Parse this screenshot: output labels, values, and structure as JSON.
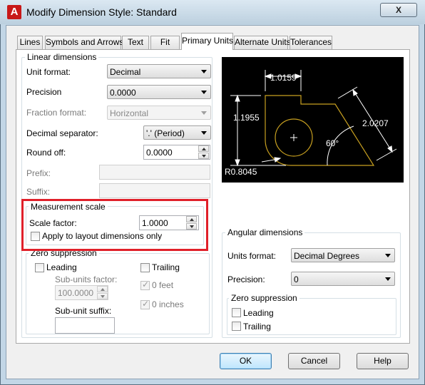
{
  "window": {
    "title": "Modify Dimension Style: Standard",
    "close_label": "X"
  },
  "tabs": [
    {
      "label": "Lines"
    },
    {
      "label": "Symbols and Arrows"
    },
    {
      "label": "Text"
    },
    {
      "label": "Fit"
    },
    {
      "label": "Primary Units",
      "active": true
    },
    {
      "label": "Alternate Units"
    },
    {
      "label": "Tolerances"
    }
  ],
  "linear": {
    "group_label": "Linear dimensions",
    "unit_format_label": "Unit format:",
    "unit_format_value": "Decimal",
    "precision_label": "Precision",
    "precision_value": "0.0000",
    "fraction_format_label": "Fraction format:",
    "fraction_format_value": "Horizontal",
    "decimal_separator_label": "Decimal separator:",
    "decimal_separator_value": "'.' (Period)",
    "round_off_label": "Round off:",
    "round_off_value": "0.0000",
    "prefix_label": "Prefix:",
    "prefix_value": "",
    "suffix_label": "Suffix:",
    "suffix_value": ""
  },
  "measurement": {
    "group_label": "Measurement scale",
    "scale_factor_label": "Scale factor:",
    "scale_factor_value": "1.0000",
    "apply_layout_label": "Apply to layout dimensions only",
    "apply_layout_checked": false
  },
  "zero_linear": {
    "group_label": "Zero suppression",
    "leading_label": "Leading",
    "trailing_label": "Trailing",
    "sub_units_factor_label": "Sub-units factor:",
    "sub_units_factor_value": "100.0000",
    "zero_feet_label": "0 feet",
    "zero_inches_label": "0 inches",
    "sub_unit_suffix_label": "Sub-unit suffix:",
    "sub_unit_suffix_value": ""
  },
  "preview": {
    "dim_top": "1.0159",
    "dim_left": "1.1955",
    "dim_right": "2.0207",
    "angle": "60°",
    "radius": "R0.8045",
    "colors": {
      "background": "#000000",
      "geometry": "#c8a020",
      "dimension": "#ffffff"
    }
  },
  "angular": {
    "group_label": "Angular dimensions",
    "units_format_label": "Units format:",
    "units_format_value": "Decimal Degrees",
    "precision_label": "Precision:",
    "precision_value": "0",
    "zero_group_label": "Zero suppression",
    "leading_label": "Leading",
    "trailing_label": "Trailing"
  },
  "buttons": {
    "ok": "OK",
    "cancel": "Cancel",
    "help": "Help"
  },
  "colors": {
    "highlight": "#e0202a",
    "app_icon": "#c81818"
  }
}
